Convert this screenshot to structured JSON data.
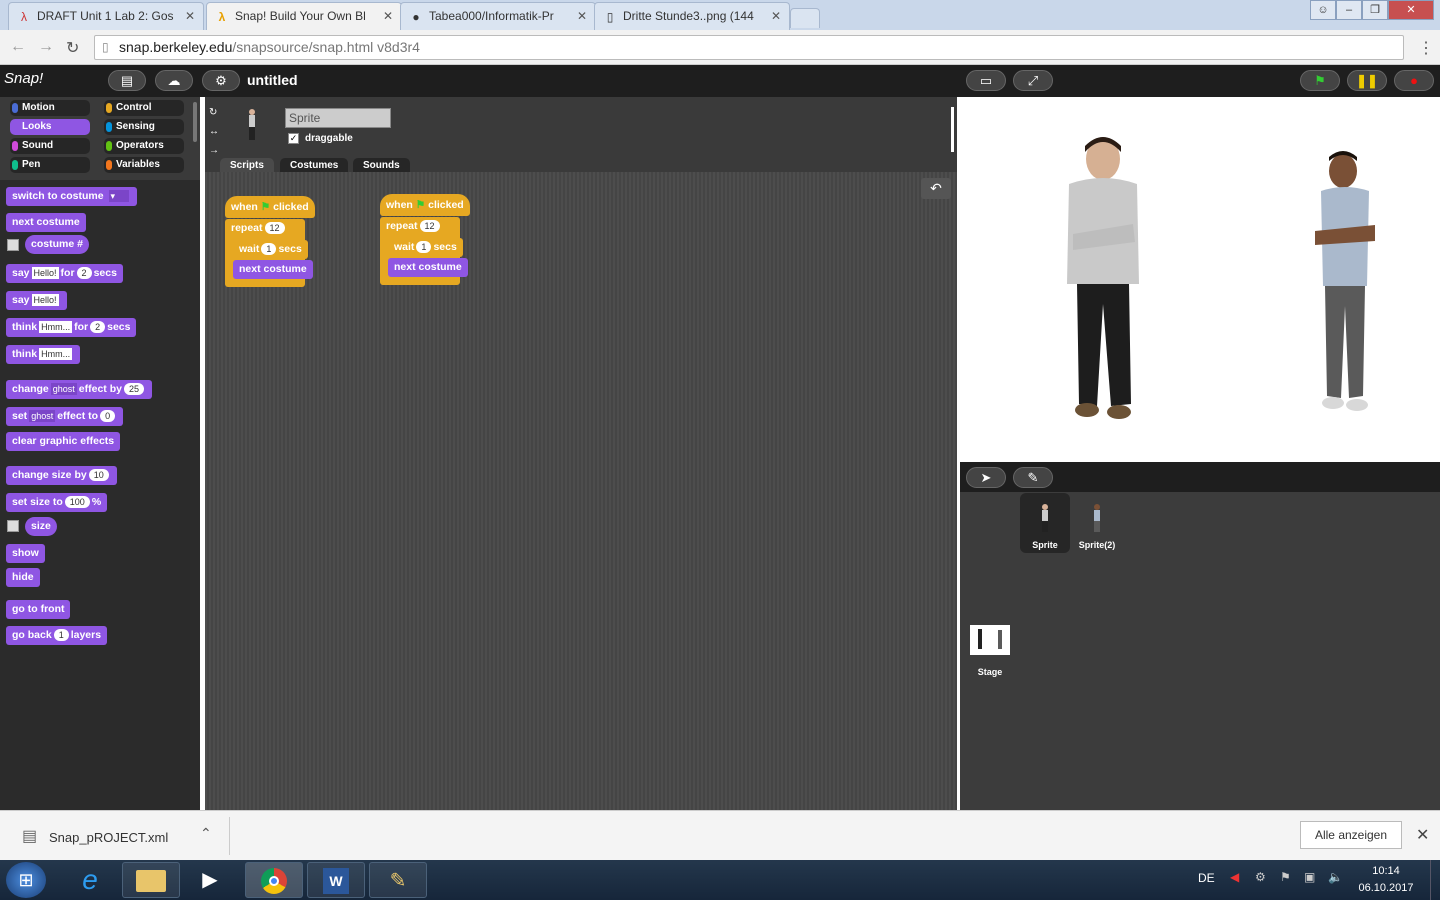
{
  "browser": {
    "tabs": [
      {
        "title": "DRAFT Unit 1 Lab 2: Gos",
        "icon": "bjc-icon"
      },
      {
        "title": "Snap! Build Your Own Bl",
        "icon": "snap-lambda-icon"
      },
      {
        "title": "Tabea000/Informatik-Pr",
        "icon": "github-icon"
      },
      {
        "title": "Dritte Stunde3..png (144",
        "icon": "file-icon"
      }
    ],
    "url_host": "snap.berkeley.edu",
    "url_path": "/snapsource/snap.html  v8d3r4"
  },
  "snap": {
    "project_name": "untitled",
    "logo": "Snap!",
    "categories": [
      "Motion",
      "Control",
      "Looks",
      "Sensing",
      "Sound",
      "Operators",
      "Pen",
      "Variables"
    ],
    "sprite_name": "Sprite",
    "draggable_label": "draggable",
    "tabs": [
      "Scripts",
      "Costumes",
      "Sounds"
    ],
    "palette": {
      "switch_to_costume": "switch to costume",
      "next_costume": "next costume",
      "costume_num": "costume #",
      "say": "say",
      "for": "for",
      "secs": "secs",
      "hello": "Hello!",
      "two": "2",
      "think": "think",
      "hmm": "Hmm...",
      "change": "change",
      "effect_by": "effect by",
      "ghost": "ghost",
      "twentyfive": "25",
      "set": "set",
      "effect_to": "effect to",
      "zero": "0",
      "clear_effects": "clear graphic effects",
      "change_size_by": "change size by",
      "ten": "10",
      "set_size_to": "set size to",
      "hundred": "100",
      "percent": "%",
      "size": "size",
      "show": "show",
      "hide": "hide",
      "go_to_front": "go to front",
      "go_back": "go back",
      "one": "1",
      "layers": "layers"
    },
    "scripts": {
      "when": "when",
      "clicked": "clicked",
      "repeat": "repeat",
      "repeat_count": "12",
      "wait": "wait",
      "wait_value": "1",
      "secs": "secs",
      "next_costume": "next costume"
    },
    "corral": {
      "sprites": [
        "Sprite",
        "Sprite(2)"
      ],
      "stage_label": "Stage"
    },
    "colors": {
      "looks": "#8f56e3",
      "control": "#e6a822",
      "motion": "#4a6cd4",
      "sound": "#cf4ad9",
      "pen": "#0fbd8c",
      "sensing": "#0494dc",
      "operators": "#62c213",
      "variables": "#f3761d"
    }
  },
  "downloads": {
    "file": "Snap_pROJECT.xml",
    "show_all": "Alle anzeigen"
  },
  "taskbar": {
    "lang": "DE",
    "time": "10:14",
    "date": "06.10.2017"
  }
}
